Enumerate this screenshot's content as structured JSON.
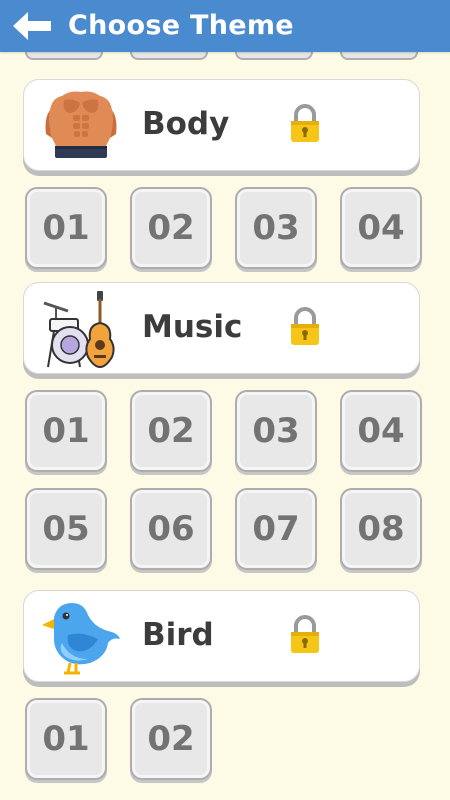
{
  "header": {
    "title": "Choose Theme"
  },
  "themes": [
    {
      "name": "Body",
      "levels": [
        "01",
        "02",
        "03",
        "04"
      ]
    },
    {
      "name": "Music",
      "levels": [
        "01",
        "02",
        "03",
        "04",
        "05",
        "06",
        "07",
        "08"
      ]
    },
    {
      "name": "Bird",
      "levels": [
        "01",
        "02"
      ]
    }
  ],
  "colors": {
    "header": "#4A8BD0",
    "background": "#FDFBE6",
    "tile": "#E8E8E8",
    "lock": "#F5C518"
  }
}
